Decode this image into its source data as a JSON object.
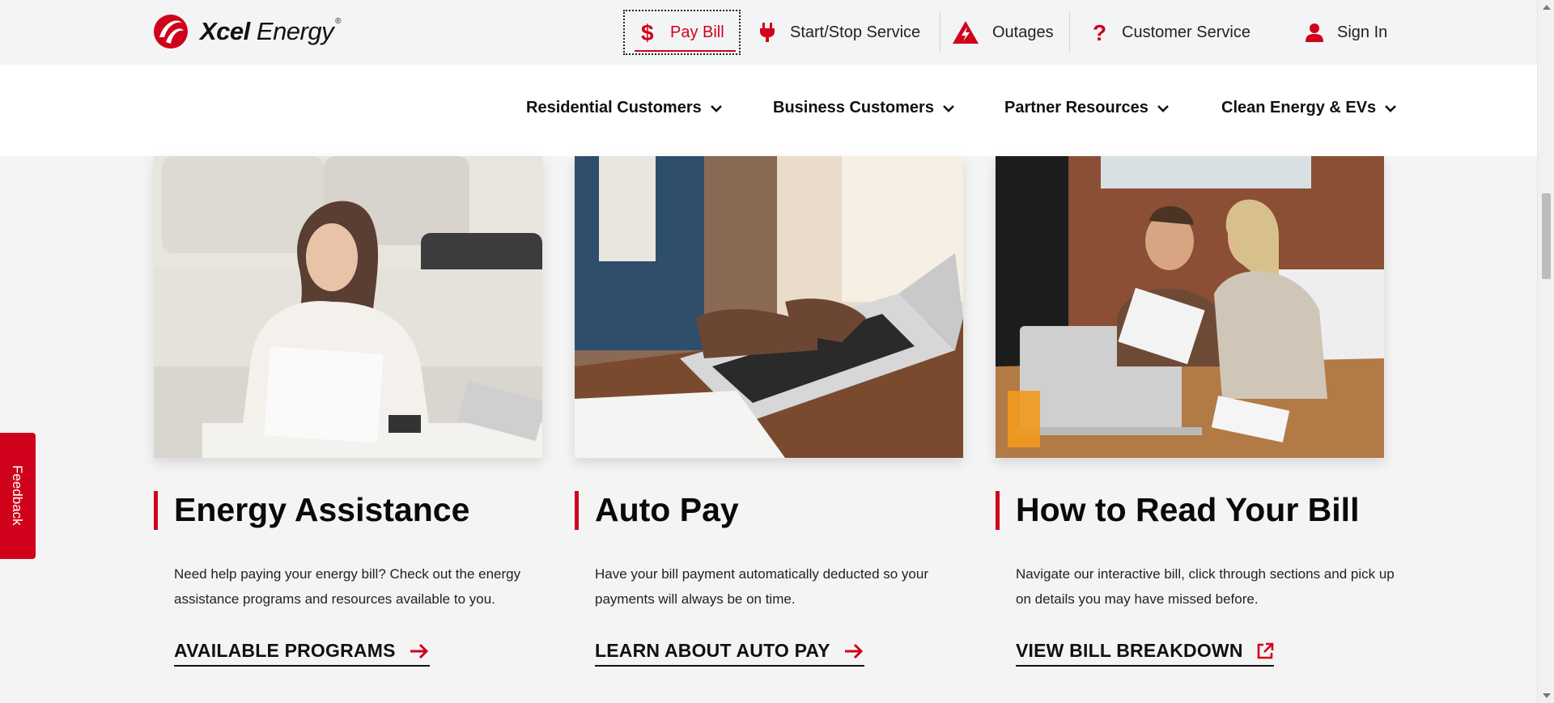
{
  "brand": {
    "name_bold": "Xcel",
    "name_rest": " Energy",
    "reg": "®",
    "color": "#d0021b"
  },
  "utility_nav": [
    {
      "label": "Pay Bill",
      "icon": "dollar-icon"
    },
    {
      "label": "Start/Stop Service",
      "icon": "plug-icon"
    },
    {
      "label": "Outages",
      "icon": "warning-bolt-icon"
    },
    {
      "label": "Customer Service",
      "icon": "question-icon"
    },
    {
      "label": "Sign In",
      "icon": "user-icon"
    }
  ],
  "main_nav": [
    {
      "label": "Residential Customers"
    },
    {
      "label": "Business Customers"
    },
    {
      "label": "Partner Resources"
    },
    {
      "label": "Clean Energy & EVs"
    }
  ],
  "cards": [
    {
      "title": "Energy Assistance",
      "description": "Need help paying your energy bill? Check out the energy assistance programs and resources available to you.",
      "cta": "AVAILABLE PROGRAMS",
      "cta_icon": "arrow-right-icon",
      "image": "woman-reviewing-bill-photo"
    },
    {
      "title": "Auto Pay",
      "description": "Have your bill payment automatically deducted so your payments will always be on time.",
      "cta": "LEARN ABOUT AUTO PAY",
      "cta_icon": "arrow-right-icon",
      "image": "hands-typing-laptop-photo"
    },
    {
      "title": "How to Read Your Bill",
      "description": "Navigate our interactive bill, click through sections and pick up on details you may have missed before.",
      "cta": "VIEW BILL BREAKDOWN",
      "cta_icon": "external-link-icon",
      "image": "couple-reading-bill-photo"
    }
  ],
  "feedback": {
    "label": "Feedback"
  }
}
